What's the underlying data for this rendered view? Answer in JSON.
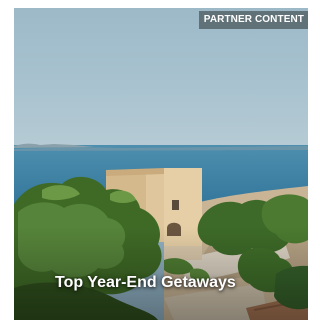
{
  "card": {
    "badge": "PARTNER CONTENT",
    "title": "Top Year-End Getaways"
  }
}
